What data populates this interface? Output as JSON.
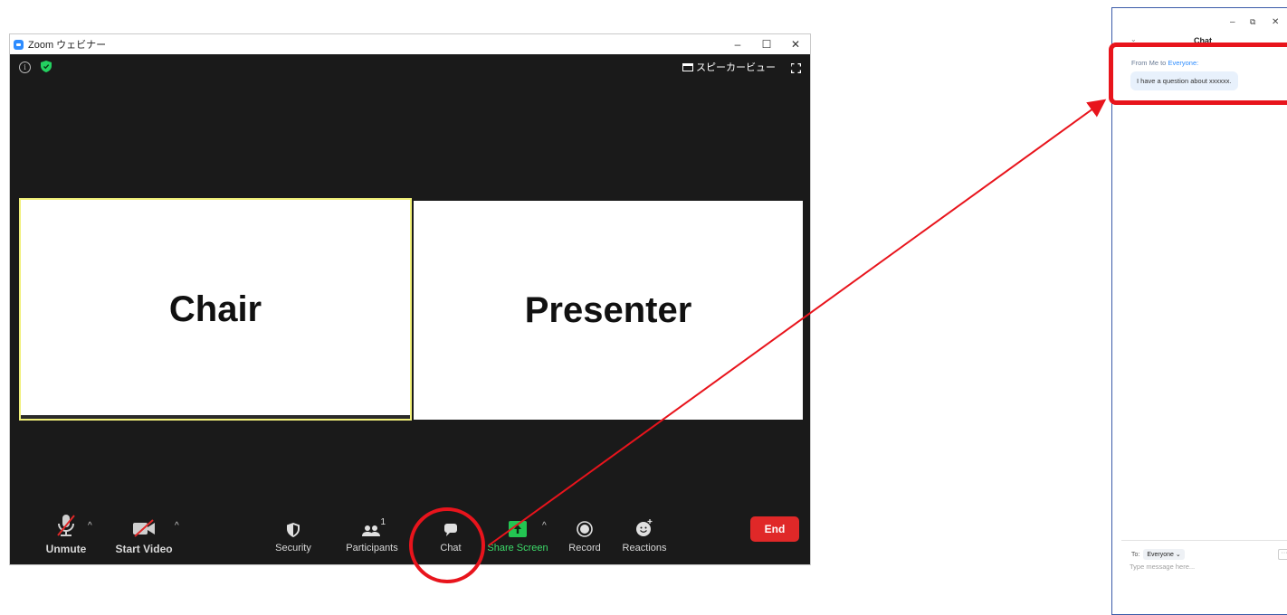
{
  "zoom_window": {
    "title": "Zoom ウェビナー",
    "window_controls": {
      "minimize": "–",
      "maximize": "☐",
      "close": "✕"
    },
    "view_label": "スピーカービュー",
    "tiles": {
      "chair": "Chair",
      "presenter": "Presenter"
    },
    "toolbar": {
      "unmute": "Unmute",
      "start_video": "Start Video",
      "security": "Security",
      "participants": "Participants",
      "participants_count": "1",
      "chat": "Chat",
      "share_screen": "Share Screen",
      "record": "Record",
      "reactions": "Reactions",
      "end": "End"
    }
  },
  "chat_window": {
    "window_controls": {
      "minimize": "–",
      "restore": "⧉",
      "close": "✕"
    },
    "collapse": "⌄",
    "title": "Chat",
    "message": {
      "from": "From Me to",
      "target": "Everyone:",
      "text": "I have a question about xxxxxx."
    },
    "to_label": "To:",
    "to_value": "Everyone ⌄",
    "more": "···",
    "input_placeholder": "Type message here..."
  },
  "colors": {
    "annotation_red": "#e8141c",
    "share_green": "#3ddc6a",
    "end_red": "#e02828",
    "everyone_blue": "#2d8cff"
  }
}
